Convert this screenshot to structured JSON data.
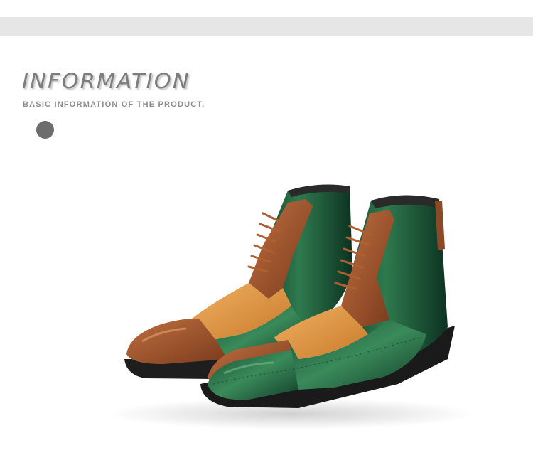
{
  "header": {
    "title": "INFORMATION",
    "subtitle": "BASIC INFORMATION OF THE PRODUCT."
  },
  "colors": {
    "band": "#e6e6e6",
    "heading": "#7d7d7d",
    "dot": "#6d6d6d",
    "leather_green": "#1f5a3a",
    "leather_tan": "#d9913f",
    "leather_brown": "#9a4f28",
    "sole": "#1e1e1e"
  },
  "image": {
    "subject": "pair-of-patchwork-leather-lace-up-ankle-boots"
  }
}
